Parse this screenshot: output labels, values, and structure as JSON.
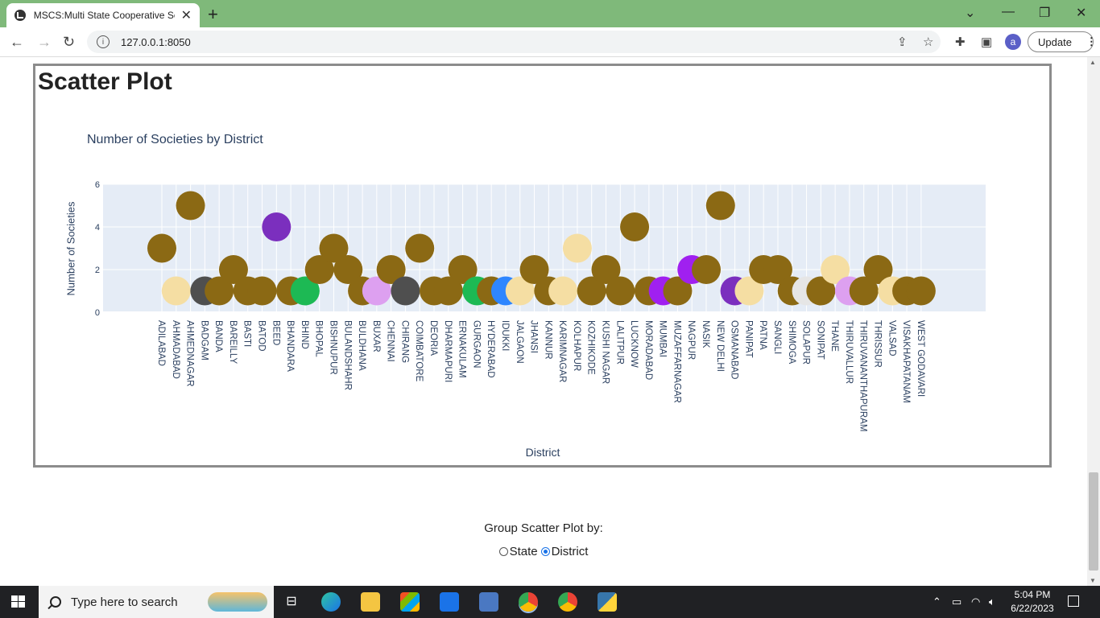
{
  "browser": {
    "tab_title": "MSCS:Multi State Cooperative Sc",
    "url": "127.0.0.1:8050",
    "update_label": "Update",
    "profile_initial": "a"
  },
  "page": {
    "heading": "Scatter Plot",
    "group_label": "Group Scatter Plot by:",
    "options": [
      {
        "label": "State",
        "selected": false
      },
      {
        "label": "District",
        "selected": true
      }
    ]
  },
  "chart_data": {
    "type": "scatter",
    "title": "Number of Societies by District",
    "xlabel": "District",
    "ylabel": "Number of Societies",
    "ylim": [
      0,
      6
    ],
    "yticks": [
      0,
      2,
      4,
      6
    ],
    "grid": true,
    "categories": [
      "ADILABAD",
      "AHMADABAD",
      "AHMEDNAGAR",
      "BADGAM",
      "BANDA",
      "BAREILLY",
      "BASTI",
      "BATOD",
      "BEED",
      "BHANDARA",
      "BHIND",
      "BHOPAL",
      "BISHNUPUR",
      "BULANDSHAHR",
      "BULDHANA",
      "BUXAR",
      "CHENNAI",
      "CHIRANG",
      "COIMBATORE",
      "DEORIA",
      "DHARMAPURI",
      "ERNAKULAM",
      "GURGAON",
      "HYDERABAD",
      "IDUKKI",
      "JALGAON",
      "JHANSI",
      "KANNUR",
      "KARIMNAGAR",
      "KOLHAPUR",
      "KOZHIKODE",
      "KUSHI NAGAR",
      "LALITPUR",
      "LUCKNOW",
      "MORADABAD",
      "MUMBAI",
      "MUZAFFARNAGAR",
      "NAGPUR",
      "NASIK",
      "NEW DELHI",
      "OSMANABAD",
      "PANIPAT",
      "PATNA",
      "SANGLI",
      "SHIMOGA",
      "SOLAPUR",
      "SONIPAT",
      "THANE",
      "THIRUVALLUR",
      "THIRUVANANTHAPURAM",
      "THRISSUR",
      "VALSAD",
      "VISAKHAPATANAM",
      "WEST GODAVARI"
    ],
    "values": [
      3,
      1,
      5,
      1,
      1,
      2,
      1,
      1,
      4,
      1,
      1,
      2,
      3,
      2,
      1,
      1,
      2,
      1,
      3,
      1,
      1,
      2,
      1,
      1,
      1,
      1,
      2,
      1,
      1,
      3,
      1,
      2,
      1,
      4,
      1,
      1,
      1,
      2,
      2,
      5,
      1,
      1,
      2,
      2,
      1,
      1,
      1,
      2,
      1,
      1,
      2,
      1,
      1,
      1
    ],
    "colors": [
      "#8B6914",
      "#F5DEA3",
      "#8B6914",
      "#4F4F4F",
      "#8B6914",
      "#8B6914",
      "#8B6914",
      "#8B6914",
      "#7B2FBE",
      "#8B6914",
      "#1DB954",
      "#8B6914",
      "#8B6914",
      "#8B6914",
      "#8B6914",
      "#DDA0F0",
      "#8B6914",
      "#4F4F4F",
      "#8B6914",
      "#8B6914",
      "#8B6914",
      "#8B6914",
      "#1DB954",
      "#8B6914",
      "#2E86FF",
      "#F5DEA3",
      "#8B6914",
      "#8B6914",
      "#F5DEA3",
      "#F5DEA3",
      "#8B6914",
      "#8B6914",
      "#8B6914",
      "#8B6914",
      "#8B6914",
      "#A020F0",
      "#8B6914",
      "#A020F0",
      "#8B6914",
      "#8B6914",
      "#7B2FBE",
      "#F5DEA3",
      "#8B6914",
      "#8B6914",
      "#8B6914",
      "#E6E6E6",
      "#8B6914",
      "#F5DEA3",
      "#DDA0F0",
      "#8B6914",
      "#8B6914",
      "#F5DEA3",
      "#8B6914",
      "#8B6914"
    ]
  },
  "taskbar": {
    "search_placeholder": "Type here to search",
    "time": "5:04 PM",
    "date": "6/22/2023"
  }
}
